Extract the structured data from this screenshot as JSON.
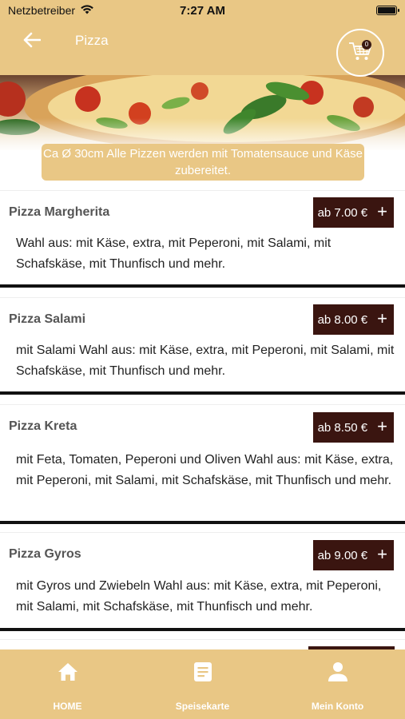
{
  "status_bar": {
    "carrier": "Netzbetreiber",
    "time": "7:27 AM"
  },
  "header": {
    "title": "Pizza",
    "cart_count": "0",
    "accent_color": "#e9c785"
  },
  "info_banner": {
    "text": "Ca Ø 30cm Alle Pizzen werden mit Tomatensauce und Käse zubereitet."
  },
  "menu_items": [
    {
      "name": "Pizza Margherita",
      "price": "ab 7.00 €",
      "description": "Wahl aus: mit Käse, extra, mit Peperoni, mit Salami, mit Schafskäse, mit Thunfisch und mehr."
    },
    {
      "name": "Pizza Salami",
      "price": "ab 8.00 €",
      "description": "mit Salami Wahl aus: mit Käse, extra, mit Peperoni, mit Salami, mit Schafskäse, mit Thunfisch und mehr."
    },
    {
      "name": "Pizza Kreta",
      "price": "ab 8.50 €",
      "description": "mit Feta, Tomaten, Peperoni und Oliven Wahl aus: mit Käse, extra, mit Peperoni, mit Salami, mit Schafskäse, mit Thunfisch und mehr."
    },
    {
      "name": "Pizza Gyros",
      "price": "ab 9.00 €",
      "description": "mit Gyros und Zwiebeln Wahl aus: mit Käse, extra, mit Peperoni, mit Salami, mit Schafskäse, mit Thunfisch und mehr."
    }
  ],
  "bottom_nav": {
    "items": [
      {
        "label": "HOME",
        "icon": "home-icon"
      },
      {
        "label": "Speisekarte",
        "icon": "menu-book-icon"
      },
      {
        "label": "Mein Konto",
        "icon": "person-icon"
      }
    ]
  },
  "colors": {
    "price_button": "#3a1510",
    "header": "#e9c785"
  }
}
